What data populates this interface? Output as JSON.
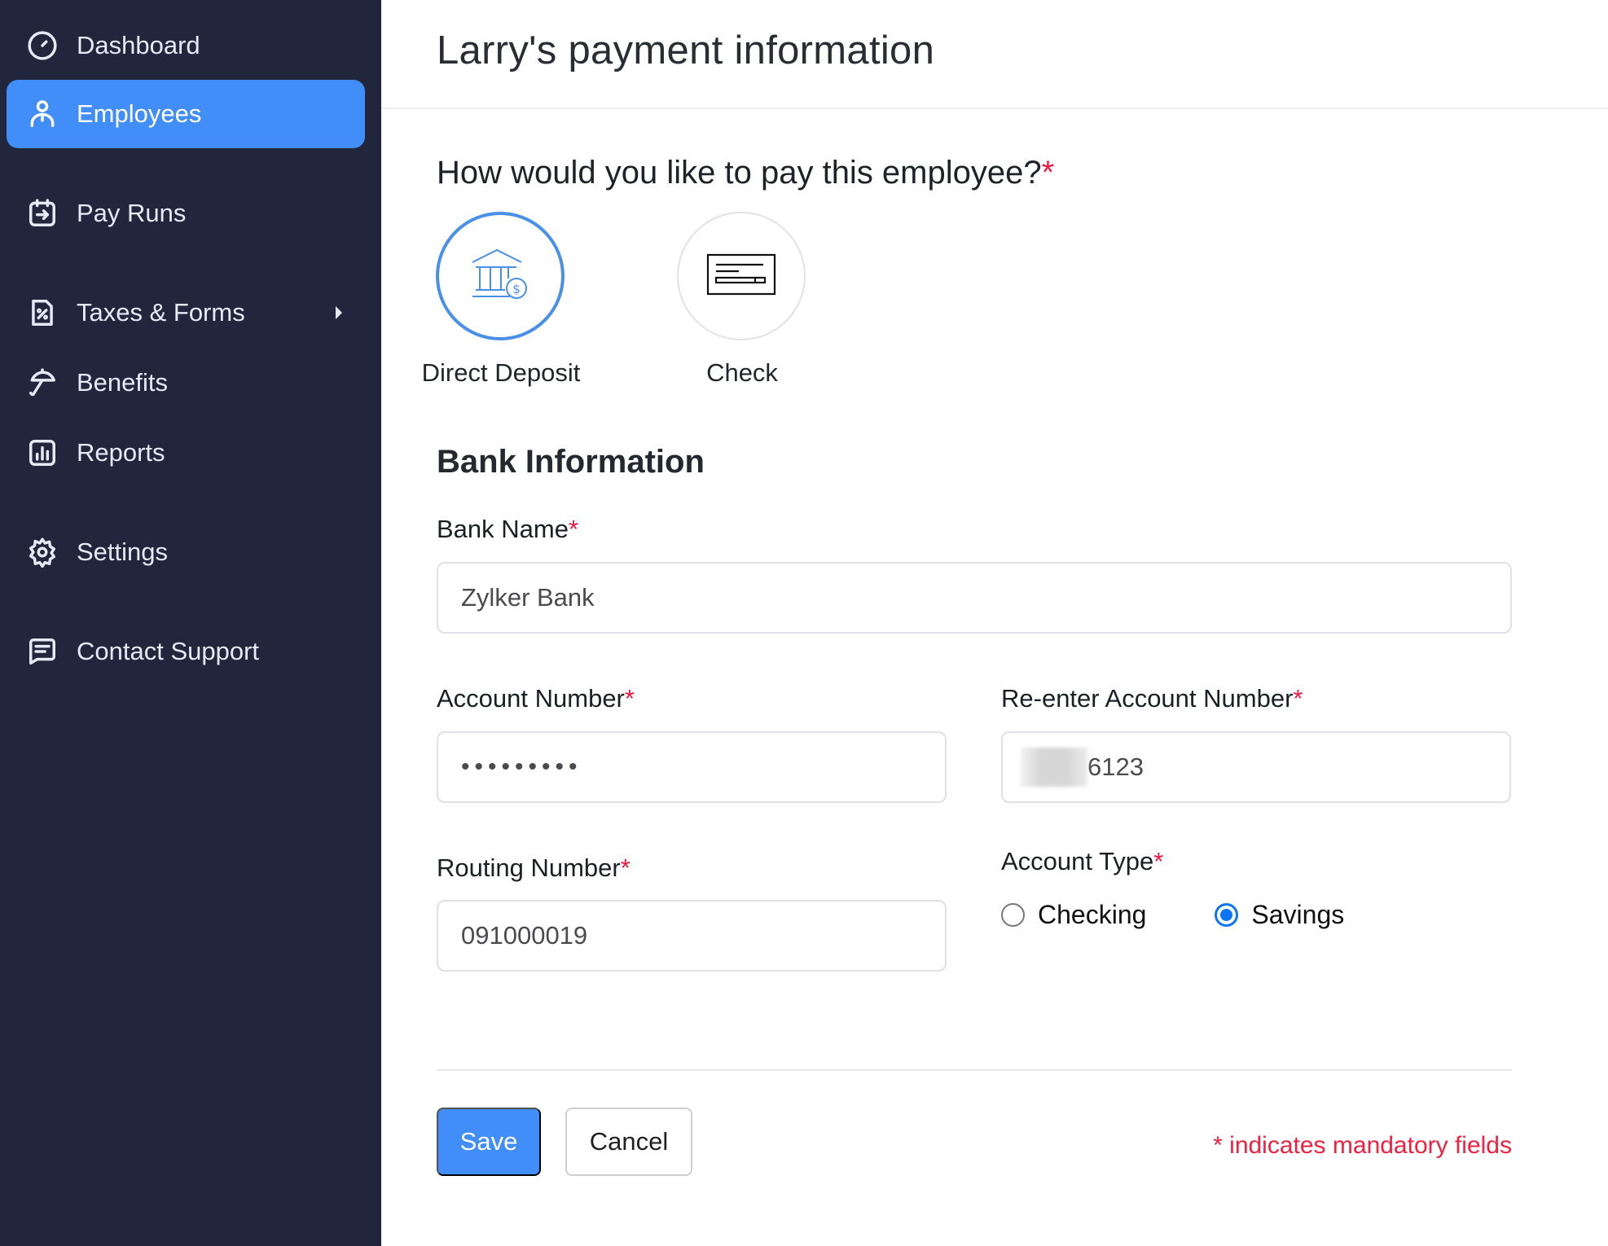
{
  "sidebar": {
    "items": [
      {
        "label": "Dashboard",
        "icon": "dashboard-gauge-icon",
        "active": false
      },
      {
        "label": "Employees",
        "icon": "user-icon",
        "active": true
      },
      {
        "label": "Pay Runs",
        "icon": "calendar-arrow-icon",
        "active": false
      },
      {
        "label": "Taxes & Forms",
        "icon": "percent-document-icon",
        "active": false,
        "has_submenu": true
      },
      {
        "label": "Benefits",
        "icon": "umbrella-icon",
        "active": false
      },
      {
        "label": "Reports",
        "icon": "bar-chart-icon",
        "active": false
      },
      {
        "label": "Settings",
        "icon": "gear-icon",
        "active": false
      },
      {
        "label": "Contact Support",
        "icon": "chat-icon",
        "active": false
      }
    ]
  },
  "header": {
    "title": "Larry's payment information"
  },
  "payment_method": {
    "question": "How would you like to pay this employee?",
    "required_marker": "*",
    "options": [
      {
        "label": "Direct Deposit",
        "icon": "bank-dollar-icon",
        "selected": true
      },
      {
        "label": "Check",
        "icon": "check-document-icon",
        "selected": false
      }
    ]
  },
  "bank_info": {
    "section_title": "Bank Information",
    "bank_name": {
      "label": "Bank Name",
      "value": "Zylker Bank"
    },
    "account_number": {
      "label": "Account Number",
      "value": "•••••••••"
    },
    "reenter_account_number": {
      "label": "Re-enter Account Number",
      "visible_suffix": "6123"
    },
    "routing_number": {
      "label": "Routing Number",
      "value": "091000019"
    },
    "account_type": {
      "label": "Account Type",
      "options": [
        {
          "label": "Checking",
          "selected": false
        },
        {
          "label": "Savings",
          "selected": true
        }
      ]
    }
  },
  "footer": {
    "save_label": "Save",
    "cancel_label": "Cancel",
    "mandatory_note": "* indicates mandatory fields"
  },
  "colors": {
    "sidebar_bg": "#22263c",
    "accent": "#428ef8",
    "required": "#f0183f",
    "radio_selected": "#0b75f5"
  }
}
